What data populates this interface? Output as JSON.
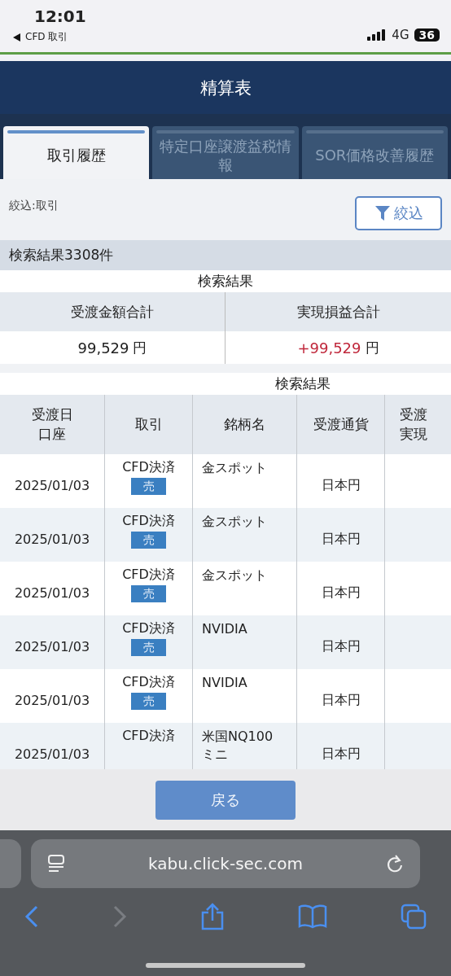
{
  "status_bar": {
    "time": "12:01",
    "back_label": "CFD 取引",
    "network": "4G",
    "battery": "36"
  },
  "header": {
    "title": "精算表"
  },
  "tabs": [
    {
      "label": "取引履歴",
      "selected": true
    },
    {
      "label": "特定口座譲渡益税情報",
      "selected": false
    },
    {
      "label": "SOR価格改善履歴",
      "selected": false
    }
  ],
  "filter": {
    "label": "絞込:取引",
    "button": "絞込"
  },
  "result_count": "検索結果3308件",
  "summary": {
    "caption": "検索結果",
    "columns": [
      {
        "heading": "受渡金額合計",
        "value": "99,529",
        "unit": "円",
        "positive": false
      },
      {
        "heading": "実現損益合計",
        "value": "+99,529",
        "unit": "円",
        "positive": true
      }
    ]
  },
  "table": {
    "caption": "検索結果",
    "columns": [
      {
        "lines": [
          "受渡日",
          "口座"
        ]
      },
      {
        "lines": [
          "取引"
        ]
      },
      {
        "lines": [
          "銘柄名"
        ]
      },
      {
        "lines": [
          "受渡通貨"
        ]
      },
      {
        "lines": [
          "受渡",
          "実現"
        ]
      }
    ],
    "rows": [
      {
        "date": "2025/01/03",
        "trade": "CFD決済",
        "side": "売",
        "name": "金スポット",
        "currency": "日本円"
      },
      {
        "date": "2025/01/03",
        "trade": "CFD決済",
        "side": "売",
        "name": "金スポット",
        "currency": "日本円"
      },
      {
        "date": "2025/01/03",
        "trade": "CFD決済",
        "side": "売",
        "name": "金スポット",
        "currency": "日本円"
      },
      {
        "date": "2025/01/03",
        "trade": "CFD決済",
        "side": "売",
        "name": "NVIDIA",
        "currency": "日本円"
      },
      {
        "date": "2025/01/03",
        "trade": "CFD決済",
        "side": "売",
        "name": "NVIDIA",
        "currency": "日本円"
      },
      {
        "date": "2025/01/03",
        "trade": "CFD決済",
        "name": "米国NQ100ミニ",
        "currency": "日本円"
      }
    ]
  },
  "back_button": "戻る",
  "browser": {
    "url": "kabu.click-sec.com"
  }
}
